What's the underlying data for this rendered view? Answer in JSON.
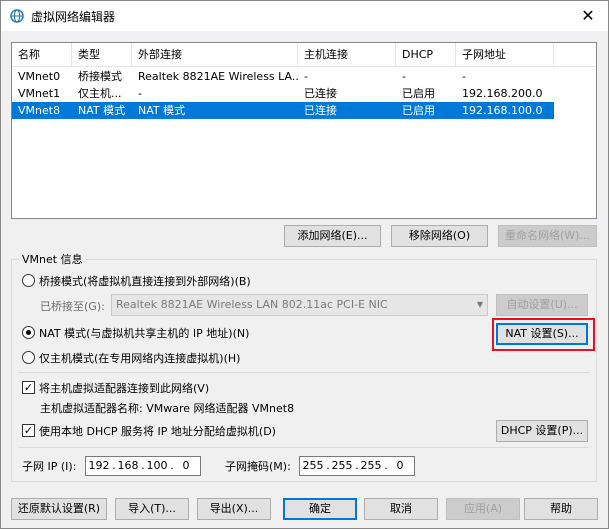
{
  "window": {
    "title": "虚拟网络编辑器",
    "close_glyph": "✕"
  },
  "table": {
    "columns": [
      "名称",
      "类型",
      "外部连接",
      "主机连接",
      "DHCP",
      "子网地址"
    ],
    "rows": [
      {
        "name": "VMnet0",
        "type": "桥接模式",
        "external": "Realtek 8821AE Wireless LA...",
        "host": "-",
        "dhcp": "-",
        "subnet": "-"
      },
      {
        "name": "VMnet1",
        "type": "仅主机...",
        "external": "-",
        "host": "已连接",
        "dhcp": "已启用",
        "subnet": "192.168.200.0"
      },
      {
        "name": "VMnet8",
        "type": "NAT 模式",
        "external": "NAT 模式",
        "host": "已连接",
        "dhcp": "已启用",
        "subnet": "192.168.100.0"
      }
    ],
    "selected_index": 2
  },
  "list_buttons": {
    "add": "添加网络(E)...",
    "remove": "移除网络(O)",
    "rename": "重命名网络(W)..."
  },
  "vmnet_info": {
    "group_title": "VMnet 信息",
    "bridged_label": "桥接模式(将虚拟机直接连接到外部网络)(B)",
    "bridged_to_label": "已桥接至(G):",
    "bridged_to_value": "Realtek 8821AE Wireless LAN 802.11ac PCI-E NIC",
    "auto_settings": "自动设置(U)...",
    "nat_label": "NAT 模式(与虚拟机共享主机的 IP 地址)(N)",
    "nat_settings": "NAT 设置(S)...",
    "hostonly_label": "仅主机模式(在专用网络内连接虚拟机)(H)",
    "selected_mode": "nat",
    "connect_adapter_label": "将主机虚拟适配器连接到此网络(V)",
    "adapter_name_label": "主机虚拟适配器名称: VMware 网络适配器 VMnet8",
    "use_dhcp_label": "使用本地 DHCP 服务将 IP 地址分配给虚拟机(D)",
    "dhcp_settings": "DHCP 设置(P)...",
    "subnet_ip_label": "子网 IP (I):",
    "subnet_ip": [
      "192",
      "168",
      "100",
      "0"
    ],
    "subnet_mask_label": "子网掩码(M):",
    "subnet_mask": [
      "255",
      "255",
      "255",
      "0"
    ]
  },
  "bottom_buttons": {
    "restore_defaults": "还原默认设置(R)",
    "import": "导入(T)...",
    "export": "导出(X)...",
    "ok": "确定",
    "cancel": "取消",
    "apply": "应用(A)",
    "help": "帮助"
  },
  "colors": {
    "selection": "#0078d7",
    "highlight_border": "#e81123"
  }
}
